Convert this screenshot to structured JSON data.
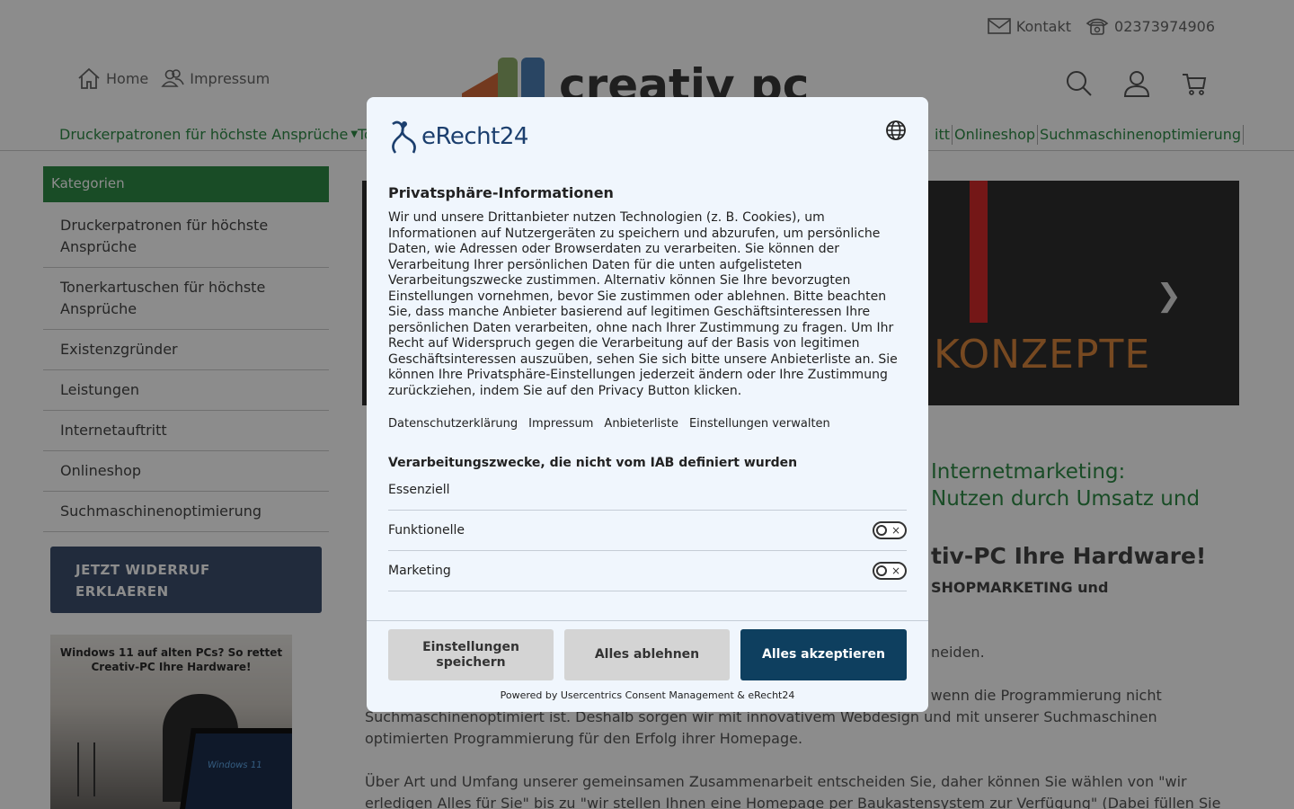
{
  "header": {
    "contact_label": "Kontakt",
    "phone": "02373974906",
    "home_label": "Home",
    "impressum_label": "Impressum",
    "logo_text": "creativ pc"
  },
  "mainnav": {
    "first": "Druckerpatronen für höchste Ansprüche",
    "partial": "To",
    "right_items": [
      "itt",
      "Onlineshop",
      "Suchmaschinenoptimierung"
    ]
  },
  "sidebar": {
    "heading": "Kategorien",
    "items": [
      "Druckerpatronen für höchste Ansprüche",
      "Tonerkartuschen für höchste Ansprüche",
      "Existenzgründer",
      "Leistungen",
      "Internetauftritt",
      "Onlineshop",
      "Suchmaschinenoptimierung"
    ],
    "widerruf_label": "JETZT WIDERRUF ERKLAEREN",
    "promo_text": "Windows 11 auf alten PCs? So rettet Creativ-PC Ihre Hardware!",
    "promo_screen": "Windows 11"
  },
  "content": {
    "slider_word": "KONZEPTE",
    "heading_green": "Internetmarketing:\n Nutzen durch Umsatz und",
    "heading_dark": "tiv-PC Ihre Hardware!",
    "subheading": "SHOPMARKETING und",
    "tail1": "neiden.",
    "tail2": "y, wenn die Programmierung nicht",
    "paragraph1": "Suchmaschinenoptimiert ist. Deshalb sorgen wir mit innovativem Webdesign und mit unserer Suchmaschinen\noptimierten Programmierung für den Erfolg ihrer Homepage.",
    "paragraph2": "Über Art und Umfang unserer gemeinsamen Zusammenarbeit entscheiden Sie, daher können Sie wählen von \"wir\nerledigen Alles für Sie\" bis zu \"wir stellen Ihnen eine Homepage per Baukastensystem zur Verfügung\" (Dabei füllen Sie"
  },
  "consent": {
    "brand": "eRecht24",
    "title": "Privatsphäre-Informationen",
    "description": "Wir und unsere Drittanbieter nutzen Technologien (z. B. Cookies), um Informationen auf Nutzergeräten zu speichern und abzurufen, um persönliche Daten, wie Adressen oder Browserdaten zu verarbeiten. Sie können der Verarbeitung Ihrer persönlichen Daten für die unten aufgelisteten Verarbeitungszwecke zustimmen. Alternativ können Sie Ihre bevorzugten Einstellungen vornehmen, bevor Sie zustimmen oder ablehnen. Bitte beachten Sie, dass manche Anbieter basierend auf legitimen Geschäftsinteressen Ihre persönlichen Daten verarbeiten, ohne nach Ihrer Zustimmung zu fragen. Um Ihr Recht auf Widerspruch gegen die Verarbeitung auf der Basis von legitimen Geschäftsinteressen auszuüben, sehen Sie sich bitte unsere Anbieterliste an. Sie können Ihre Privatsphäre-Einstellungen jederzeit ändern oder Ihre Zustimmung zurückziehen, indem Sie auf den Privacy Button klicken.",
    "links": [
      "Datenschutzerklärung",
      "Impressum",
      "Anbieterliste",
      "Einstellungen verwalten"
    ],
    "section_title": "Verarbeitungszwecke, die nicht vom IAB definiert wurden",
    "purposes": [
      {
        "label": "Essenziell",
        "toggle": false
      },
      {
        "label": "Funktionelle",
        "toggle": true,
        "on": false
      },
      {
        "label": "Marketing",
        "toggle": true,
        "on": false
      }
    ],
    "btn_save": "Einstellungen speichern",
    "btn_reject": "Alles ablehnen",
    "btn_accept": "Alles akzeptieren",
    "powered": "Powered by Usercentrics Consent Management & eRecht24",
    "toggle_off_symbol": "×"
  },
  "colors": {
    "green": "#2e8b45",
    "navy": "#3c4f6e",
    "accept": "#0e3f5f"
  }
}
